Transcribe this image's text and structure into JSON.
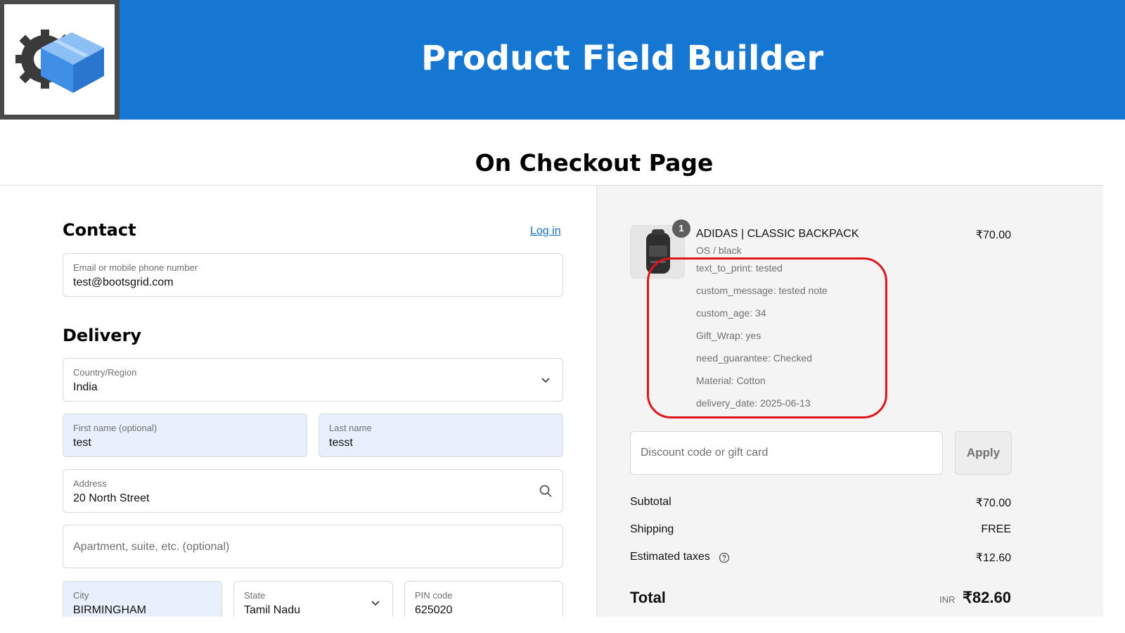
{
  "header": {
    "title": "Product Field Builder",
    "logo_icon": "gear-box-logo-icon",
    "brand_color": "#1677d2"
  },
  "subtitle": "On Checkout Page",
  "contact": {
    "title": "Contact",
    "login_link": "Log in",
    "email_label": "Email or mobile phone number",
    "email_value": "test@bootsgrid.com"
  },
  "delivery": {
    "title": "Delivery",
    "country_label": "Country/Region",
    "country_value": "India",
    "first_name_label": "First name (optional)",
    "first_name_value": "test",
    "last_name_label": "Last name",
    "last_name_value": "tesst",
    "address_label": "Address",
    "address_value": "20 North Street",
    "apartment_placeholder": "Apartment, suite, etc. (optional)",
    "city_label": "City",
    "city_value": "BIRMINGHAM",
    "state_label": "State",
    "state_value": "Tamil Nadu",
    "pin_label": "PIN code",
    "pin_value": "625020"
  },
  "order": {
    "quantity_badge": "1",
    "product_title": "ADIDAS | CLASSIC BACKPACK",
    "product_price": "₹70.00",
    "variant": "OS / black",
    "properties": [
      "text_to_print: tested",
      "custom_message: tested note",
      "custom_age: 34",
      "Gift_Wrap: yes",
      "need_guarantee: Checked",
      "Material: Cotton",
      "delivery_date: 2025-06-13"
    ],
    "highlight_color": "#e0141b",
    "discount_placeholder": "Discount code or gift card",
    "apply_label": "Apply",
    "subtotal_label": "Subtotal",
    "subtotal_value": "₹70.00",
    "shipping_label": "Shipping",
    "shipping_value": "FREE",
    "taxes_label": "Estimated taxes",
    "taxes_value": "₹12.60",
    "total_label": "Total",
    "total_currency": "INR",
    "total_value": "₹82.60"
  }
}
